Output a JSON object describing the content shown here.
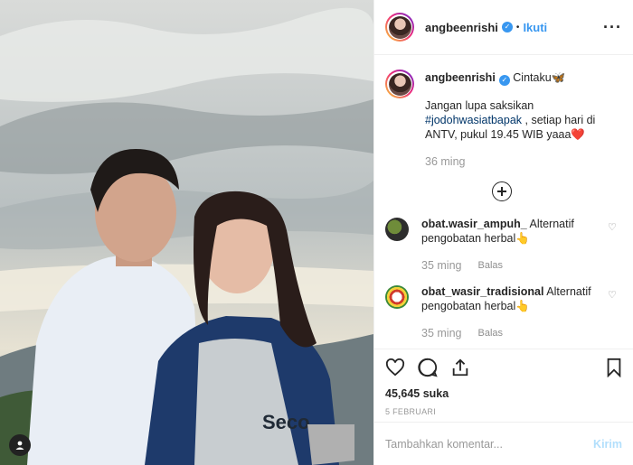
{
  "post": {
    "username": "angbeenrishi",
    "follow_label": "Ikuti",
    "dot": "•",
    "more_icon": "more-options-icon"
  },
  "caption": {
    "username": "angbeenrishi",
    "text_line1": "Cintaku🦋",
    "text_line2": "Jangan lupa saksikan",
    "hashtag": "#jodohwasiatbapak",
    "text_line3_rest": " , setiap hari di",
    "text_line4": "ANTV, pukul 19.45 WIB yaaa❤️",
    "time": "36 ming"
  },
  "comments": [
    {
      "username": "obat.wasir_ampuh_",
      "text": "Alternatif pengobatan herbal👆",
      "time": "35 ming",
      "reply_label": "Balas"
    },
    {
      "username": "obat_wasir_tradisional",
      "text": "Alternatif pengobatan herbal👆",
      "time": "35 ming",
      "reply_label": "Balas"
    }
  ],
  "actions": {
    "likes": "45,645 suka",
    "date": "5 FEBRUARI"
  },
  "composer": {
    "placeholder": "Tambahkan komentar...",
    "post_label": "Kirim"
  },
  "colors": {
    "link": "#3897f0",
    "hashtag": "#003569",
    "muted": "#999999"
  }
}
